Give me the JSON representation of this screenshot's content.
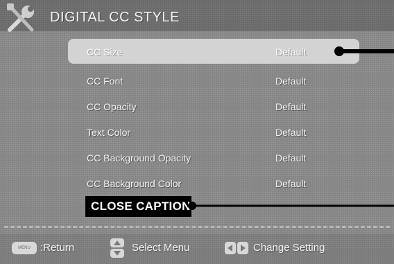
{
  "header": {
    "title": "DIGITAL CC STYLE",
    "icon": "tools-icon"
  },
  "menu": {
    "items": [
      {
        "label": "CC Size",
        "value": "Default",
        "selected": true
      },
      {
        "label": "CC Font",
        "value": "Default",
        "selected": false
      },
      {
        "label": "CC Opacity",
        "value": "Default",
        "selected": false
      },
      {
        "label": "Text Color",
        "value": "Default",
        "selected": false
      },
      {
        "label": "CC Background Opacity",
        "value": "Default",
        "selected": false
      },
      {
        "label": "CC Background Color",
        "value": "Default",
        "selected": false
      }
    ]
  },
  "callout": {
    "label": "CLOSE CAPTION"
  },
  "footer": {
    "menu_key": "MENU",
    "return_label": ":Return",
    "select_label": "Select Menu",
    "change_label": "Change Setting"
  },
  "colors": {
    "background": "#858585",
    "header": "#6a6a6a",
    "selected_row": "#d3d3d3",
    "callout": "#000000"
  }
}
